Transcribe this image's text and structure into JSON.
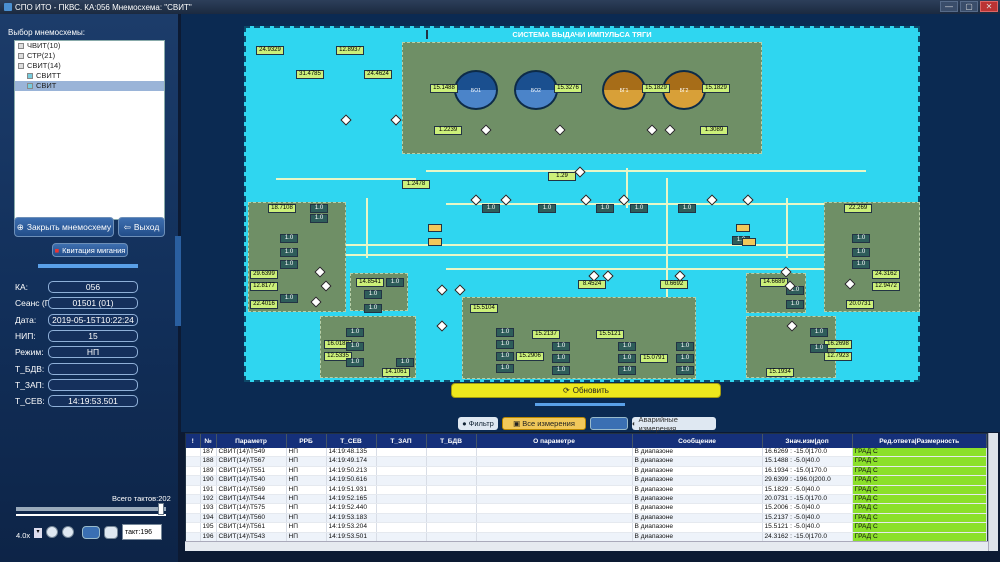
{
  "window": {
    "title": "СПО ИТО - ПКВС. КА:056 Мнемосхема: \"СВИТ\"",
    "min": "—",
    "max": "▢",
    "close": "✕"
  },
  "left": {
    "tree_label": "Выбор мнемосхемы:",
    "tree": [
      {
        "label": "ЧВИТ(10)",
        "indent": 0,
        "selected": false
      },
      {
        "label": "СТР(21)",
        "indent": 0,
        "selected": false
      },
      {
        "label": "СВИТ(14)",
        "indent": 0,
        "selected": false
      },
      {
        "label": "СВИТТ",
        "indent": 1,
        "selected": false
      },
      {
        "label": "СВИТ",
        "indent": 1,
        "selected": true
      }
    ],
    "close_btn": "Закрыть мнемосхему",
    "exit_btn": "Выход",
    "ack_btn": "Квитация мигания",
    "fields": [
      {
        "label": "КА:",
        "value": "056"
      },
      {
        "label": "Сеанс (Прогон):",
        "value": "01501 (01)"
      },
      {
        "label": "Дата:",
        "value": "2019-05-15T10:22:24"
      },
      {
        "label": "НИП:",
        "value": "15"
      },
      {
        "label": "Режим:",
        "value": "НП"
      },
      {
        "label": "Т_БДВ:",
        "value": ""
      },
      {
        "label": "Т_ЗАП:",
        "value": ""
      },
      {
        "label": "Т_СЕВ:",
        "value": "14:19:53.501"
      }
    ],
    "total_ticks": "Всего тактов:202",
    "speed": "4.0x",
    "tick": "такт:196"
  },
  "diagram": {
    "title": "СИСТЕМА ВЫДАЧИ ИМПУЛЬСА ТЯГИ",
    "tanks": [
      {
        "label": "БО1",
        "color": "blue"
      },
      {
        "label": "БО2",
        "color": "blue"
      },
      {
        "label": "БГ1",
        "color": "gold"
      },
      {
        "label": "БГ2",
        "color": "gold"
      }
    ],
    "values": [
      "24.9329",
      "12.8937",
      "31.4785",
      "24.4624",
      "15.1488",
      "15.3276",
      "15.1829",
      "15.1829",
      "1.2239",
      "1.3089",
      "1.29",
      "1.2478",
      "18.7108",
      "29.6399",
      "12.8177",
      "22.4016",
      "14.8541",
      "16.0183",
      "12.5335",
      "14.1061",
      "15.5104",
      "15.2137",
      "15.5121",
      "15.2906",
      "15.0791",
      "22.269",
      "24.3162",
      "12.9472",
      "20.0731",
      "14.6689",
      "16.2698",
      "12.7923",
      "15.1934",
      "8.4524",
      "0.6692"
    ],
    "ones": "1.0"
  },
  "refresh_btn": "Обновить",
  "tabs": {
    "filter": "Фильтр",
    "all": "Все измерения",
    "alarm": "Аварийные измерения"
  },
  "table": {
    "columns": [
      "!",
      "№",
      "Параметр",
      "РРБ",
      "Т_СЕВ",
      "Т_ЗАП",
      "Т_БДВ",
      "О параметре",
      "Сообщение",
      "Знач.изм|доп",
      "Ред.ответа|Размерность"
    ],
    "rows": [
      [
        "",
        "187",
        "СВИТ(14)\\Т549",
        "НП",
        "14:19:48.135",
        "",
        "",
        "",
        "В диапазоне",
        "16.6269 : -15.0|170.0",
        "ГРАД С"
      ],
      [
        "",
        "188",
        "СВИТ(14)\\Т567",
        "НП",
        "14:19:49.174",
        "",
        "",
        "",
        "В диапазоне",
        "15.1488 : -5.0|40.0",
        "ГРАД С"
      ],
      [
        "",
        "189",
        "СВИТ(14)\\Т551",
        "НП",
        "14:19:50.213",
        "",
        "",
        "",
        "В диапазоне",
        "16.1934 : -15.0|170.0",
        "ГРАД С"
      ],
      [
        "",
        "190",
        "СВИТ(14)\\Т540",
        "НП",
        "14:19:50.616",
        "",
        "",
        "",
        "В диапазоне",
        "29.6399 : -196.0|200.0",
        "ГРАД С"
      ],
      [
        "",
        "191",
        "СВИТ(14)\\Т569",
        "НП",
        "14:19:51.931",
        "",
        "",
        "",
        "В диапазоне",
        "15.1829 : -5.0|40.0",
        "ГРАД С"
      ],
      [
        "",
        "192",
        "СВИТ(14)\\Т544",
        "НП",
        "14:19:52.165",
        "",
        "",
        "",
        "В диапазоне",
        "20.0731 : -15.0|170.0",
        "ГРАД С"
      ],
      [
        "",
        "193",
        "СВИТ(14)\\Т575",
        "НП",
        "14:19:52.440",
        "",
        "",
        "",
        "В диапазоне",
        "15.2006 : -5.0|40.0",
        "ГРАД С"
      ],
      [
        "",
        "194",
        "СВИТ(14)\\Т560",
        "НП",
        "14:19:53.183",
        "",
        "",
        "",
        "В диапазоне",
        "15.2137 : -5.0|40.0",
        "ГРАД С"
      ],
      [
        "",
        "195",
        "СВИТ(14)\\Т561",
        "НП",
        "14:19:53.204",
        "",
        "",
        "",
        "В диапазоне",
        "15.5121 : -5.0|40.0",
        "ГРАД С"
      ],
      [
        "",
        "196",
        "СВИТ(14)\\Т543",
        "НП",
        "14:19:53.501",
        "",
        "",
        "",
        "В диапазоне",
        "24.3162 : -15.0|170.0",
        "ГРАД С"
      ]
    ]
  },
  "colors": {
    "status_ok": "#8be02a",
    "diagram_bg": "#2fd6f0",
    "panel": "#12305b"
  }
}
